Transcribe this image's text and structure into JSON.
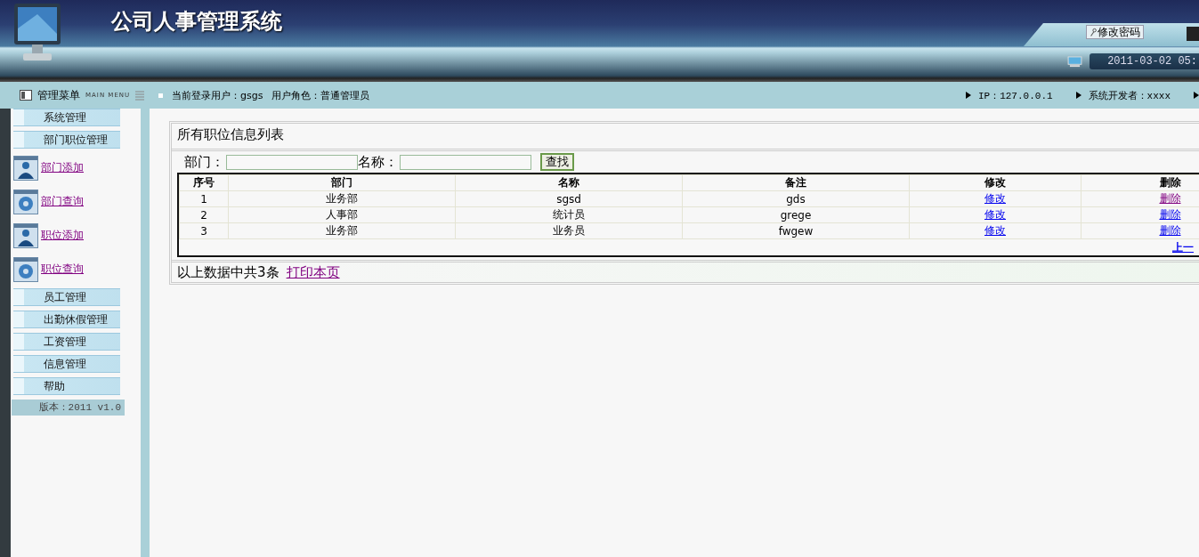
{
  "header": {
    "title": "公司人事管理系统",
    "password_button": "修改密码",
    "datetime": "2011-03-02 05:"
  },
  "info_bar": {
    "menu_title": "管理菜单",
    "menu_subtitle": "MAIN MENU",
    "current_user": "当前登录用户：gsgs",
    "user_role": "用户角色：普通管理员",
    "ip": "IP：127.0.0.1",
    "developer": "系统开发者：xxxx"
  },
  "sidebar": {
    "items": [
      {
        "kind": "group",
        "label": "系统管理"
      },
      {
        "kind": "group",
        "label": "部门职位管理"
      },
      {
        "kind": "add",
        "label": "部门添加",
        "visited": true
      },
      {
        "kind": "query",
        "label": "部门查询",
        "visited": true
      },
      {
        "kind": "add",
        "label": "职位添加",
        "visited": true
      },
      {
        "kind": "query",
        "label": "职位查询",
        "visited": true
      },
      {
        "kind": "group",
        "label": "员工管理"
      },
      {
        "kind": "group",
        "label": "出勤休假管理"
      },
      {
        "kind": "group",
        "label": "工资管理"
      },
      {
        "kind": "group",
        "label": "信息管理"
      },
      {
        "kind": "group",
        "label": "帮助"
      }
    ],
    "version": "版本：2011 v1.0"
  },
  "panel": {
    "title": "所有职位信息列表",
    "search": [
      {
        "label": "部门："
      },
      {
        "label": "名称："
      }
    ],
    "search_button": "查找",
    "table": {
      "columns": [
        "序号",
        "部门",
        "名称",
        "备注",
        "修改",
        "删除"
      ],
      "rows": [
        {
          "index": "1",
          "department": "业务部",
          "name": "sgsd",
          "note": "gds",
          "edit": "修改",
          "edit_visited": false,
          "delete": "删除",
          "delete_visited": true
        },
        {
          "index": "2",
          "department": "人事部",
          "name": "统计员",
          "note": "grege",
          "edit": "修改",
          "edit_visited": false,
          "delete": "删除",
          "delete_visited": false
        },
        {
          "index": "3",
          "department": "业务部",
          "name": "业务员",
          "note": "fwgew",
          "edit": "修改",
          "edit_visited": false,
          "delete": "删除",
          "delete_visited": false
        }
      ],
      "pager": "上一"
    },
    "summary": "以上数据中共3条",
    "print_link": "打印本页"
  }
}
